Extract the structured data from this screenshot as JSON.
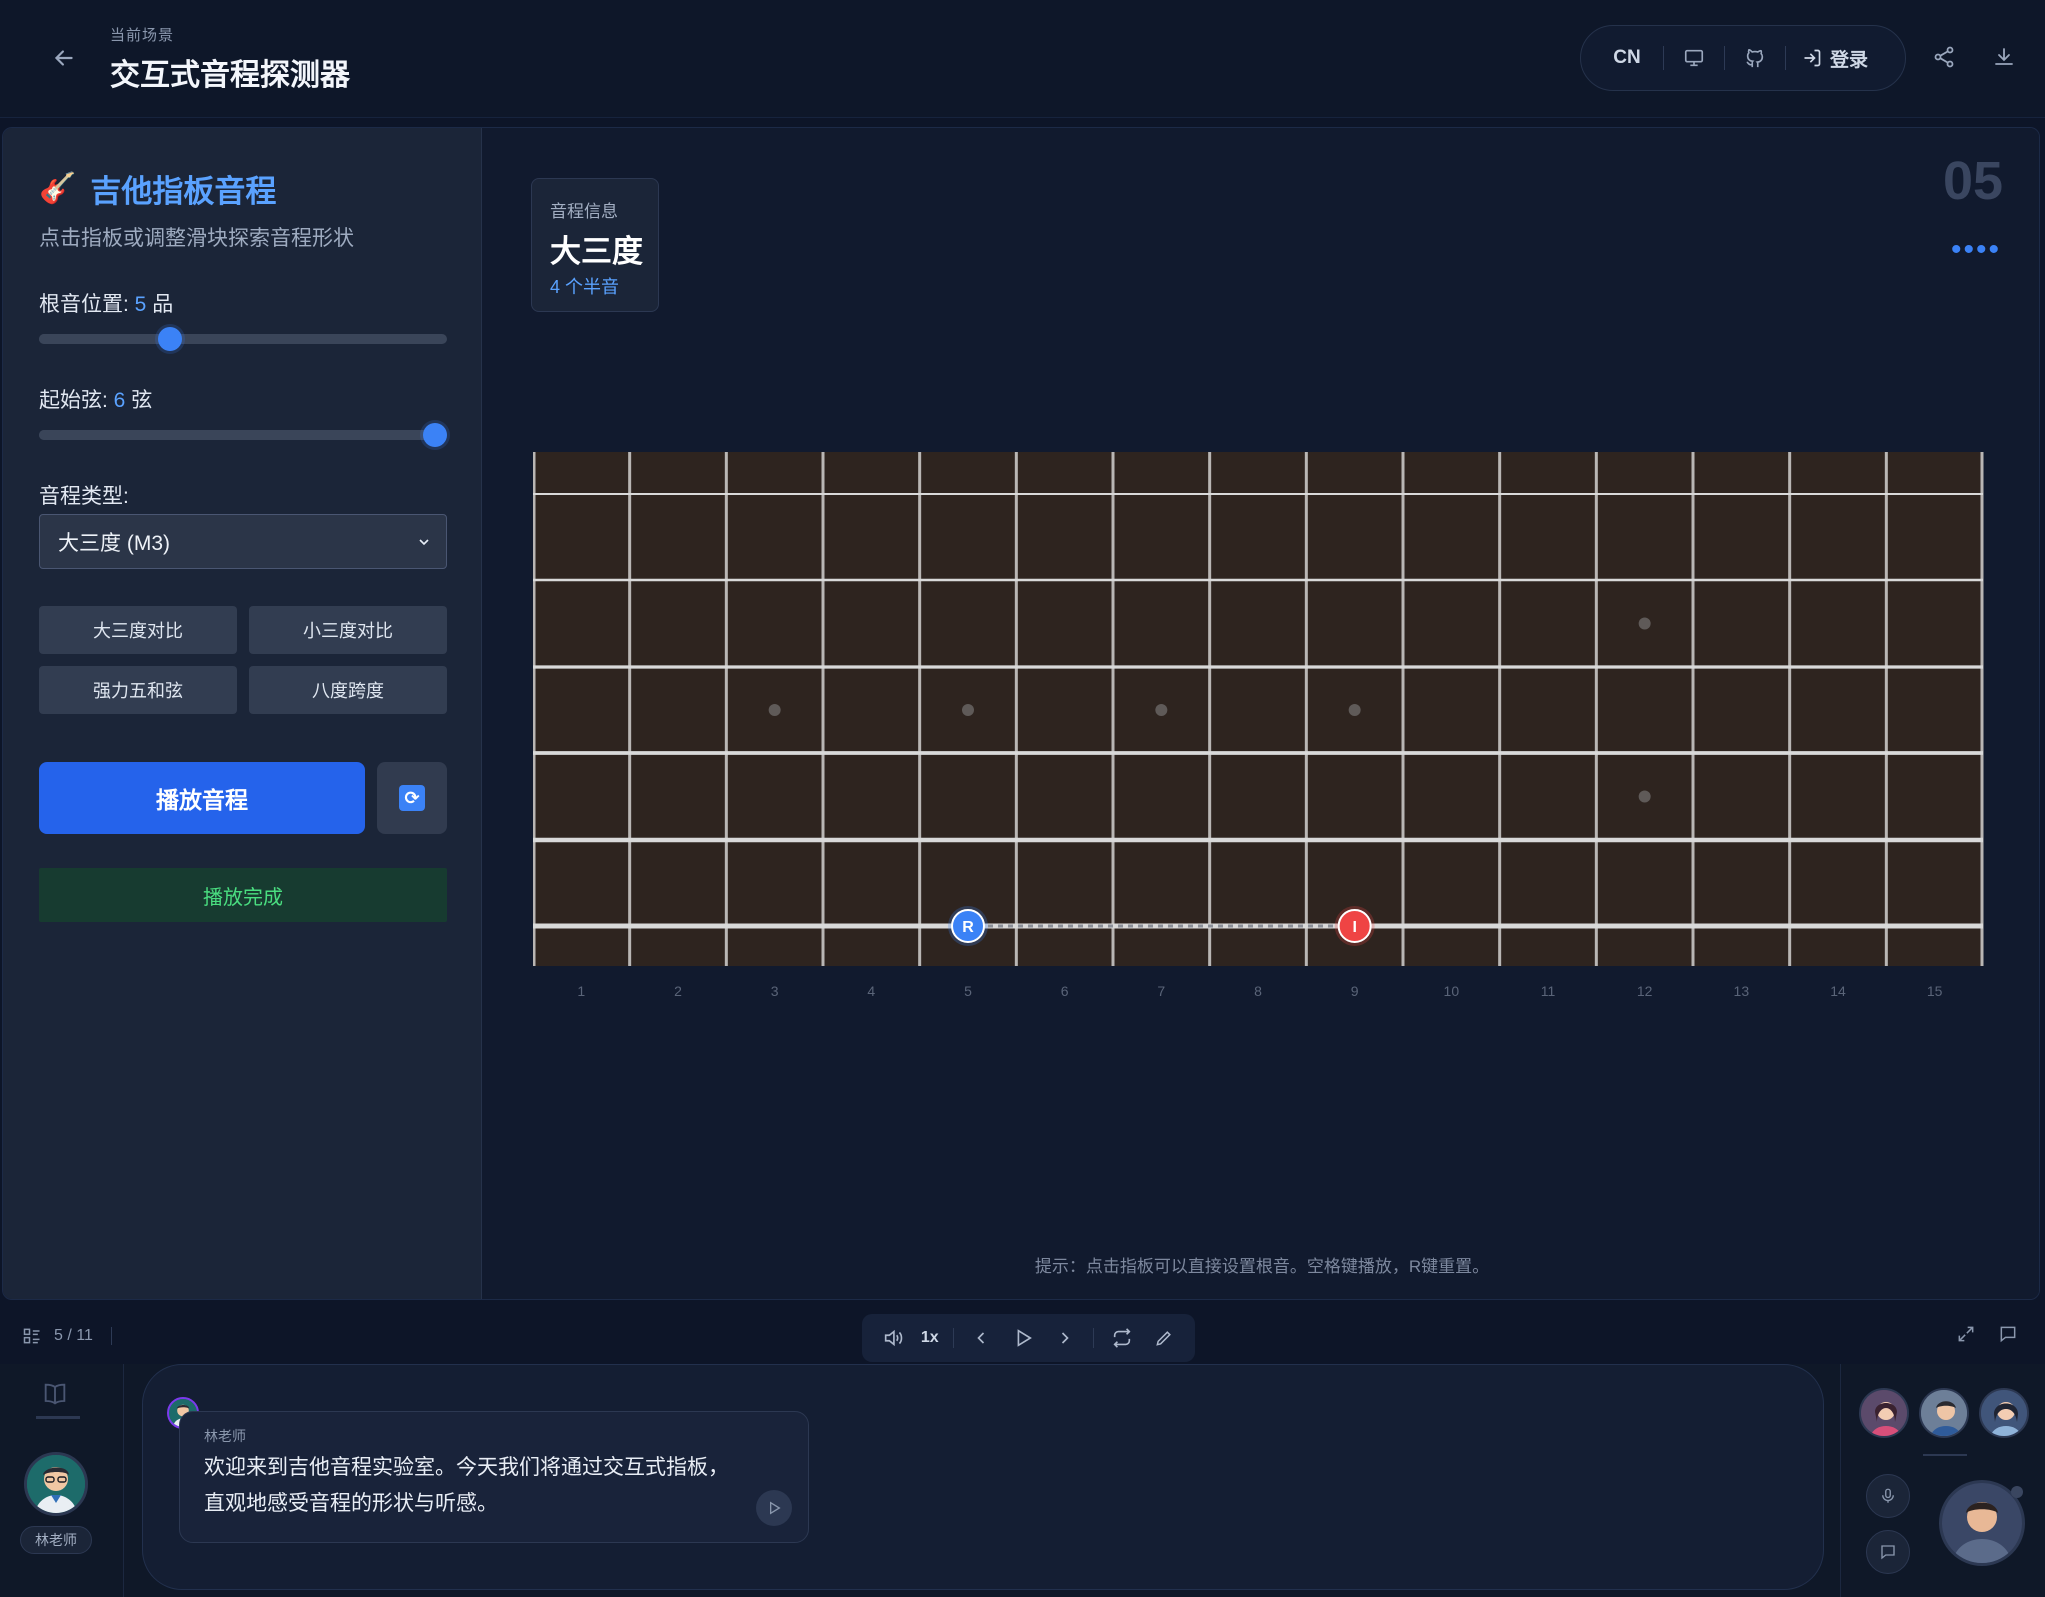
{
  "header": {
    "scene_subtitle": "当前场景",
    "title": "交互式音程探测器",
    "lang": "CN",
    "login_label": "登录"
  },
  "left_panel": {
    "title": "吉他指板音程",
    "description": "点击指板或调整滑块探索音程形状",
    "root_label_prefix": "根音位置: ",
    "root_value": "5",
    "root_label_suffix": " 品",
    "root_slider_fraction": 0.31,
    "string_label_prefix": "起始弦: ",
    "string_value": "6",
    "string_label_suffix": " 弦",
    "string_slider_fraction": 1.0,
    "interval_type_label": "音程类型:",
    "interval_selected": "大三度 (M3)",
    "presets": [
      "大三度对比",
      "小三度对比",
      "强力五和弦",
      "八度跨度"
    ],
    "play_label": "播放音程",
    "status": "播放完成"
  },
  "info_card": {
    "label": "音程信息",
    "name": "大三度",
    "semitones": "4",
    "semitones_suffix": "个半音"
  },
  "page_number": "05",
  "fretboard": {
    "fret_numbers": [
      "1",
      "2",
      "3",
      "4",
      "5",
      "6",
      "7",
      "8",
      "9",
      "10",
      "11",
      "12",
      "13",
      "14",
      "15"
    ],
    "root_fret": 5,
    "interval_fret": 9,
    "string": 6,
    "root_marker": "R",
    "interval_marker": "I",
    "single_dot_frets": [
      3,
      5,
      7,
      9
    ],
    "double_dot_frets": [
      12
    ],
    "colors": {
      "board": "#2e241f",
      "root": "#3b82f6",
      "interval": "#ef4444"
    }
  },
  "tip": "提示：点击指板可以直接设置根音。空格键播放，R键重置。",
  "control_bar": {
    "page_indicator": "5 / 11",
    "speed": "1x"
  },
  "chat": {
    "teacher_name": "林老师",
    "message": "欢迎来到吉他音程实验室。今天我们将通过交互式指板，直观地感受音程的形状与听感。"
  }
}
